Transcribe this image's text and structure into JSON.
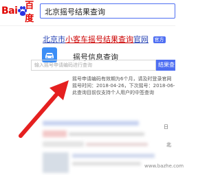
{
  "header": {
    "logo_left": "Bai",
    "logo_right": "百度",
    "search_query": "北京摇号结果查询"
  },
  "result": {
    "title_plain_1": "北京市",
    "title_hl_1": "小客车摇号结果查询",
    "title_plain_2": "官网",
    "official_badge": "官方"
  },
  "card": {
    "title": "摇号信息查询",
    "input_placeholder": "输入摇号申请编码进行查询",
    "button_label": "结果查",
    "notice_line1": "摇号申请编码有效期为6个月，请及时登录官网",
    "notice_line2": "摇号时间：2018-04-26，下次摇号：2018-06-",
    "notice_line3": "此查询目前仅支持个人用户的中签查询"
  },
  "blurred": {
    "badge": "日",
    "side_text": "北",
    "watermark": "www.bazhe.com"
  },
  "colors": {
    "link": "#2440b3",
    "highlight": "#cc0000",
    "accent": "#4e6ef2",
    "arrow": "#e52020"
  }
}
